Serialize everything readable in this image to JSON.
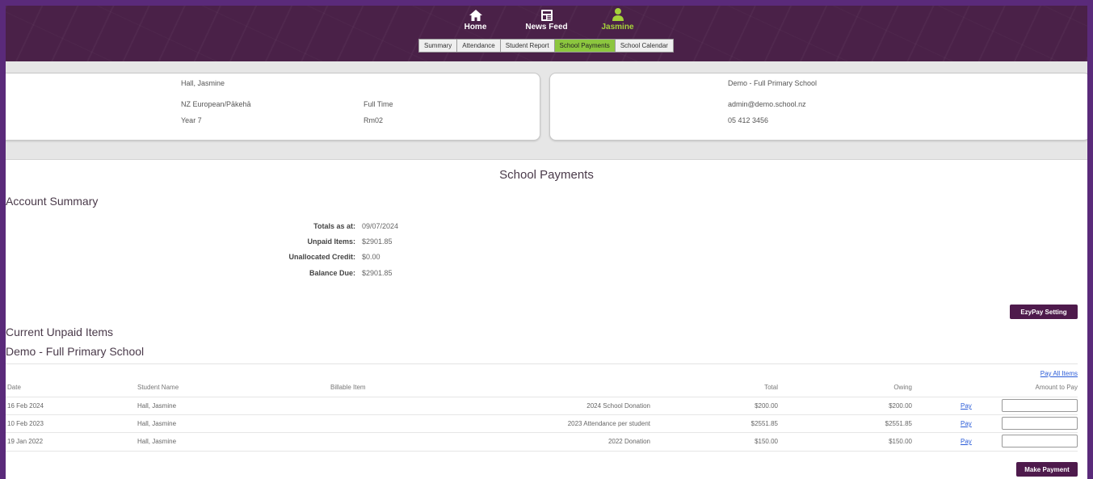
{
  "nav": {
    "items": [
      {
        "label": "Home",
        "icon": "home-icon"
      },
      {
        "label": "News Feed",
        "icon": "newspaper-icon"
      },
      {
        "label": "Jasmine",
        "icon": "person-icon",
        "active": true
      }
    ]
  },
  "subtabs": [
    "Summary",
    "Attendance",
    "Student Report",
    "School Payments",
    "School Calendar"
  ],
  "active_subtab": "School Payments",
  "student": {
    "name": "Hall, Jasmine",
    "ethnicity": "NZ European/Pākehā",
    "attendance_type": "Full Time",
    "year": "Year 7",
    "room": "Rm02"
  },
  "school": {
    "name": "Demo - Full Primary School",
    "email": "admin@demo.school.nz",
    "phone": "05 412 3456"
  },
  "payments": {
    "title": "School Payments",
    "account_summary_heading": "Account Summary",
    "summary": [
      {
        "label": "Totals as at:",
        "value": "09/07/2024"
      },
      {
        "label": "Unpaid Items:",
        "value": "$2901.85"
      },
      {
        "label": "Unallocated Credit:",
        "value": "$0.00"
      },
      {
        "label": "Balance Due:",
        "value": "$2901.85"
      }
    ],
    "ezypay_button": "EzyPay Setting",
    "unpaid_heading": "Current Unpaid Items",
    "school_heading": "Demo - Full Primary School",
    "pay_all_label": "Pay All Items",
    "columns": {
      "date": "Date",
      "student": "Student Name",
      "item": "Billable Item",
      "total": "Total",
      "owing": "Owing",
      "amount": "Amount to Pay"
    },
    "rows": [
      {
        "date": "16 Feb 2024",
        "student": "Hall, Jasmine",
        "item": "2024 School Donation",
        "total": "$200.00",
        "owing": "$200.00",
        "pay": "Pay"
      },
      {
        "date": "10 Feb 2023",
        "student": "Hall, Jasmine",
        "item": "2023 Attendance per student",
        "total": "$2551.85",
        "owing": "$2551.85",
        "pay": "Pay"
      },
      {
        "date": "19 Jan 2022",
        "student": "Hall, Jasmine",
        "item": "2022 Donation",
        "total": "$150.00",
        "owing": "$150.00",
        "pay": "Pay"
      }
    ],
    "make_payment_button": "Make Payment"
  },
  "colors": {
    "header": "#4a2148",
    "accent_green": "#8cc63f",
    "button": "#4e1a4c",
    "link": "#2a5bd7"
  }
}
